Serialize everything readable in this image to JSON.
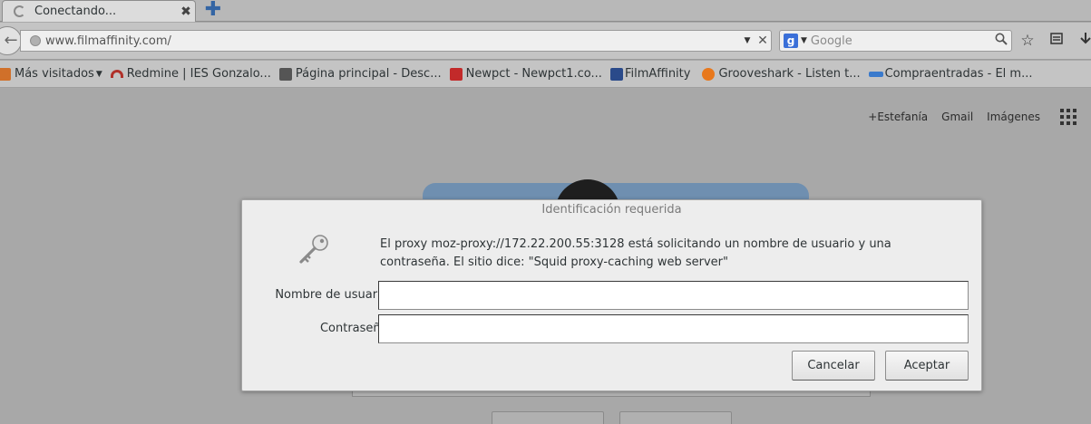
{
  "tab": {
    "title": "Conectando...",
    "close": "✖",
    "new_tab": "✚"
  },
  "navbar": {
    "url": "www.filmaffinity.com/",
    "search_engine_letter": "g",
    "search_placeholder": "Google"
  },
  "bookmarks": [
    {
      "label": "Más visitados",
      "dropdown": true,
      "icon": "folder-icon",
      "color": "#d0702a"
    },
    {
      "label": "Redmine | IES Gonzalo...",
      "icon": "redmine-icon",
      "color": "#b0312a"
    },
    {
      "label": "Página principal - Desc...",
      "icon": "wiki-icon",
      "color": "#555555"
    },
    {
      "label": "Newpct - Newpct1.co...",
      "icon": "newpct-icon",
      "color": "#c22a2a"
    },
    {
      "label": "FilmAffinity",
      "icon": "filmaffinity-icon",
      "color": "#2a4a8a"
    },
    {
      "label": "Grooveshark - Listen t...",
      "icon": "grooveshark-icon",
      "color": "#e8781c"
    },
    {
      "label": "Compraentradas - El m...",
      "icon": "compraentradas-icon",
      "color": "#3a7acc"
    }
  ],
  "google": {
    "links": [
      "+Estefanía",
      "Gmail",
      "Imágenes"
    ]
  },
  "dialog": {
    "title": "Identificación requerida",
    "message": "El proxy moz-proxy://172.22.200.55:3128 está solicitando un nombre de usuario y una contraseña. El sitio dice: \"Squid proxy-caching web server\"",
    "username_label": "Nombre de usuario:",
    "username_value": "",
    "password_label": "Contraseña:",
    "password_value": "",
    "cancel_label": "Cancelar",
    "accept_label": "Aceptar"
  },
  "colors": {
    "accent": "#3465a4",
    "dim_overlay": "#a8a8a8",
    "dialog_bg": "#ededed"
  }
}
